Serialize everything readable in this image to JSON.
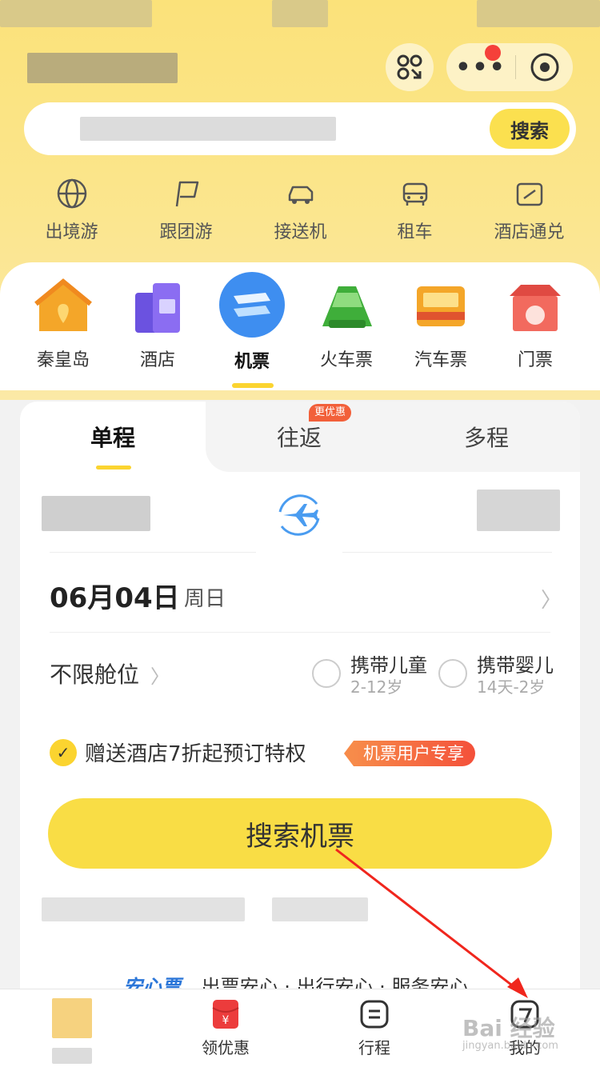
{
  "search": {
    "button_label": "搜索"
  },
  "quick_links": [
    {
      "label": "出境游",
      "icon": "globe-icon"
    },
    {
      "label": "跟团游",
      "icon": "flag-icon"
    },
    {
      "label": "接送机",
      "icon": "car-plane-icon"
    },
    {
      "label": "租车",
      "icon": "car-icon"
    },
    {
      "label": "酒店通兑",
      "icon": "ticket-icon"
    }
  ],
  "categories": [
    {
      "label": "秦皇岛",
      "icon": "house-pin-icon"
    },
    {
      "label": "酒店",
      "icon": "hotel-icon"
    },
    {
      "label": "机票",
      "icon": "plane-icon",
      "active": true
    },
    {
      "label": "火车票",
      "icon": "train-icon"
    },
    {
      "label": "汽车票",
      "icon": "bus-icon"
    },
    {
      "label": "门票",
      "icon": "gate-icon"
    }
  ],
  "flight": {
    "tabs": {
      "single": "单程",
      "round": "往返",
      "multi": "多程"
    },
    "round_badge": "更优惠",
    "date": "06月04日",
    "weekday": "周日",
    "cabin": "不限舱位",
    "child": {
      "label": "携带儿童",
      "sub": "2-12岁"
    },
    "infant": {
      "label": "携带婴儿",
      "sub": "14天-2岁"
    },
    "perk": "赠送酒店7折起预订特权",
    "perk_tag": "机票用户专享",
    "search_button": "搜索机票",
    "assurance_title": "安心票",
    "assurance_items": "出票安心 · 出行安心 · 服务安心"
  },
  "tabbar": {
    "coupon": "领优惠",
    "trip": "行程",
    "mine": "我的"
  },
  "watermark": {
    "main": "Bai 经验",
    "sub": "jingyan.baidu.com"
  },
  "colors": {
    "brand_yellow": "#fbd430",
    "accent_red": "#f4503a",
    "assure_blue": "#2b76d8"
  }
}
